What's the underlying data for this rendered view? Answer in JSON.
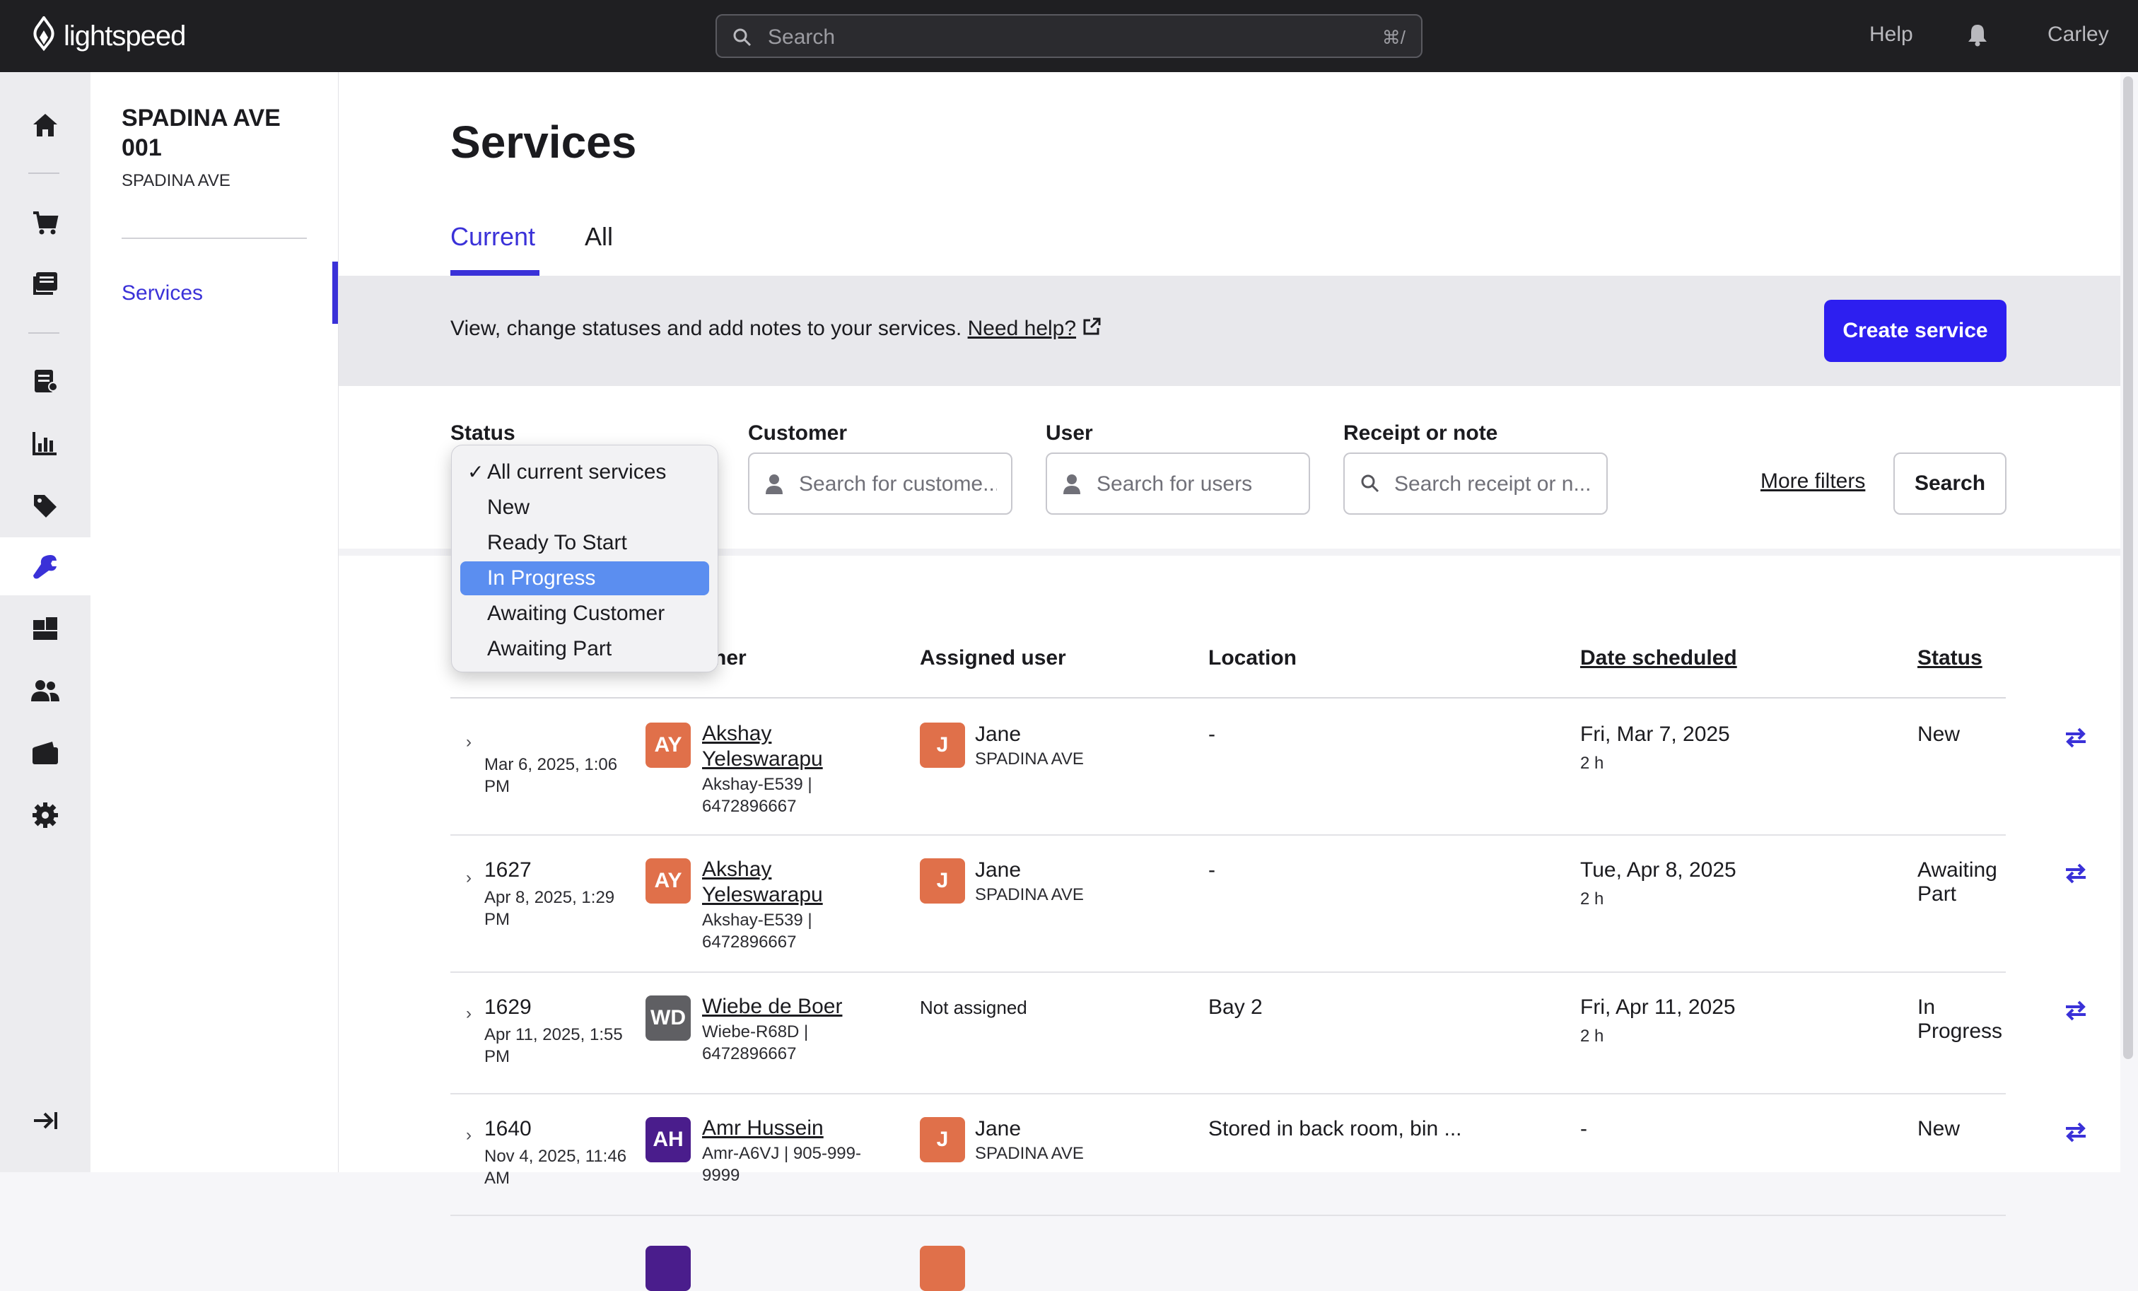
{
  "topbar": {
    "brand": "lightspeed",
    "search_placeholder": "Search",
    "search_shortcut": "⌘/",
    "help": "Help",
    "user": "Carley"
  },
  "rail": {
    "icons": [
      "home-icon",
      "cart-icon",
      "catalog-icon",
      "register-icon",
      "reports-icon",
      "tag-icon",
      "wrench-icon",
      "inventory-icon",
      "customers-icon",
      "wallet-icon",
      "gear-icon",
      "collapse-icon"
    ],
    "active": "wrench-icon"
  },
  "subnav": {
    "store_name": "SPADINA AVE 001",
    "store_sub": "SPADINA AVE",
    "item": "Services"
  },
  "page": {
    "title": "Services",
    "tabs": [
      "Current",
      "All"
    ],
    "info_text": "View, change statuses and add notes to your services.",
    "help_link": "Need help?",
    "create_button": "Create service"
  },
  "filters": {
    "status_label": "Status",
    "customer_label": "Customer",
    "customer_placeholder": "Search for custome...",
    "user_label": "User",
    "user_placeholder": "Search for users",
    "receipt_label": "Receipt or note",
    "receipt_placeholder": "Search receipt or n...",
    "more_filters": "More filters",
    "search_button": "Search"
  },
  "status_dropdown": {
    "options": [
      "All current services",
      "New",
      "Ready To Start",
      "In Progress",
      "Awaiting Customer",
      "Awaiting Part"
    ],
    "checked": "All current services",
    "highlighted": "In Progress",
    "check_mark": "✓"
  },
  "table": {
    "headers": [
      "ner",
      "Assigned user",
      "Location",
      "Date scheduled",
      "Status"
    ],
    "rows": [
      {
        "num": "",
        "date": "Mar 6, 2025, 1:06 PM",
        "initials": "AY",
        "avatar_color": "#e0704a",
        "customer": "Akshay Yeleswarapu",
        "meta": "Akshay-E539 | 6472896667",
        "user_initial": "J",
        "user": "Jane",
        "user_loc": "SPADINA AVE",
        "location": "-",
        "scheduled": "Fri, Mar 7, 2025",
        "duration": "2 h",
        "status": "New"
      },
      {
        "num": "1627",
        "date": "Apr 8, 2025, 1:29 PM",
        "initials": "AY",
        "avatar_color": "#e0704a",
        "customer": "Akshay Yeleswarapu",
        "meta": "Akshay-E539 | 6472896667",
        "user_initial": "J",
        "user": "Jane",
        "user_loc": "SPADINA AVE",
        "location": "-",
        "scheduled": "Tue, Apr 8, 2025",
        "duration": "2 h",
        "status": "Awaiting Part"
      },
      {
        "num": "1629",
        "date": "Apr 11, 2025, 1:55 PM",
        "initials": "WD",
        "avatar_color": "#5f5f63",
        "customer": "Wiebe de Boer",
        "meta": "Wiebe-R68D | 6472896667",
        "user_text": "Not assigned",
        "location": "Bay 2",
        "scheduled": "Fri, Apr 11, 2025",
        "duration": "2 h",
        "status": "In Progress"
      },
      {
        "num": "1640",
        "date": "Nov 4, 2025, 11:46 AM",
        "initials": "AH",
        "avatar_color": "#4a1d8c",
        "customer": "Amr Hussein",
        "meta": "Amr-A6VJ | 905-999-9999",
        "user_initial": "J",
        "user": "Jane",
        "user_loc": "SPADINA AVE",
        "location": "Stored in back room, bin ...",
        "scheduled": "-",
        "duration": "",
        "status": "New"
      }
    ]
  },
  "colors": {
    "accent": "#3a31d8",
    "primary_button": "#2d1ff0",
    "topbar": "#1f1f22",
    "highlight": "#5b8ef0"
  }
}
